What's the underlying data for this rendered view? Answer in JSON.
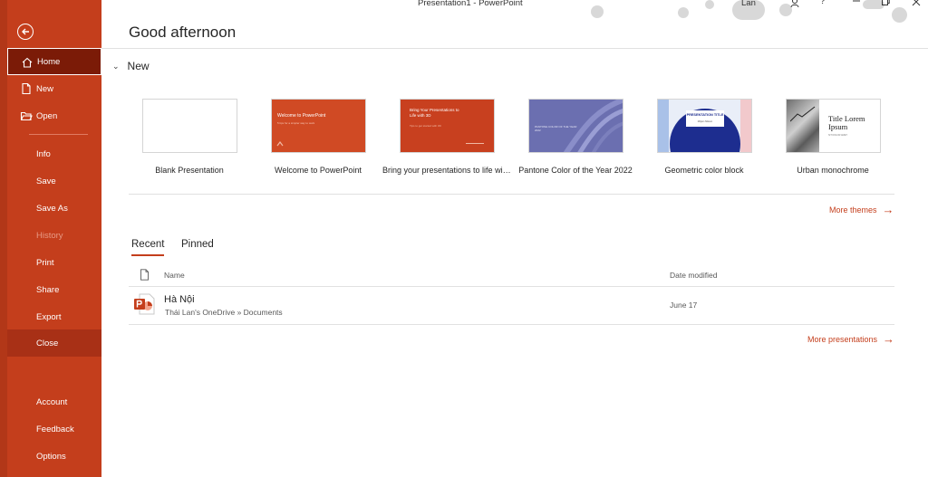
{
  "titlebar": {
    "doc_title": "Presentation1  -  PowerPoint",
    "user_name": "Lan",
    "icons": [
      "person-icon",
      "help-icon",
      "minimize-icon",
      "restore-icon",
      "close-icon"
    ]
  },
  "sidebar": {
    "back_icon": "back-arrow-icon",
    "items": [
      {
        "label": "Home",
        "icon": "home-icon",
        "state": "active"
      },
      {
        "label": "New",
        "icon": "new-file-icon",
        "state": "normal"
      },
      {
        "label": "Open",
        "icon": "folder-icon",
        "state": "normal"
      },
      {
        "label": "Info",
        "state": "normal"
      },
      {
        "label": "Save",
        "state": "normal"
      },
      {
        "label": "Save As",
        "state": "normal"
      },
      {
        "label": "History",
        "state": "disabled"
      },
      {
        "label": "Print",
        "state": "normal"
      },
      {
        "label": "Share",
        "state": "normal"
      },
      {
        "label": "Export",
        "state": "normal"
      },
      {
        "label": "Close",
        "state": "selected"
      },
      {
        "label": "Account",
        "state": "normal"
      },
      {
        "label": "Feedback",
        "state": "normal"
      },
      {
        "label": "Options",
        "state": "normal"
      }
    ]
  },
  "main": {
    "greeting": "Good afternoon",
    "new_section": "New",
    "templates": [
      {
        "label": "Blank Presentation"
      },
      {
        "label": "Welcome to PowerPoint",
        "thumb_text": "Welcome to PowerPoint",
        "thumb_sub": "5 tips for a simpler way to work"
      },
      {
        "label": "Bring your presentations to life with 3D",
        "thumb_text": "Bring Your Presentations to Life with 3D",
        "thumb_sub": "Tips to get started with 3D"
      },
      {
        "label": "Pantone Color of the Year 2022",
        "thumb_text": "PANTONE COLOR OF THE YEAR 2022"
      },
      {
        "label": "Geometric color block",
        "thumb_text": "PRESENTATION TITLE",
        "thumb_sub": "Mirjam Nilsson"
      },
      {
        "label": "Urban monochrome",
        "thumb_text": "Title Lorem Ipsum",
        "thumb_sub": "SIT DOLOR AMET"
      }
    ],
    "more_themes": "More themes",
    "tabs": [
      "Recent",
      "Pinned"
    ],
    "columns": {
      "name": "Name",
      "date": "Date modified"
    },
    "files": [
      {
        "name": "Hà Nội",
        "path": "Thái Lan's OneDrive » Documents",
        "date": "June 17"
      }
    ],
    "more_presentations": "More presentations"
  },
  "colors": {
    "accent": "#c43e1c",
    "sidebar_active": "#7b1b07",
    "sidebar_selected": "#a83016"
  }
}
